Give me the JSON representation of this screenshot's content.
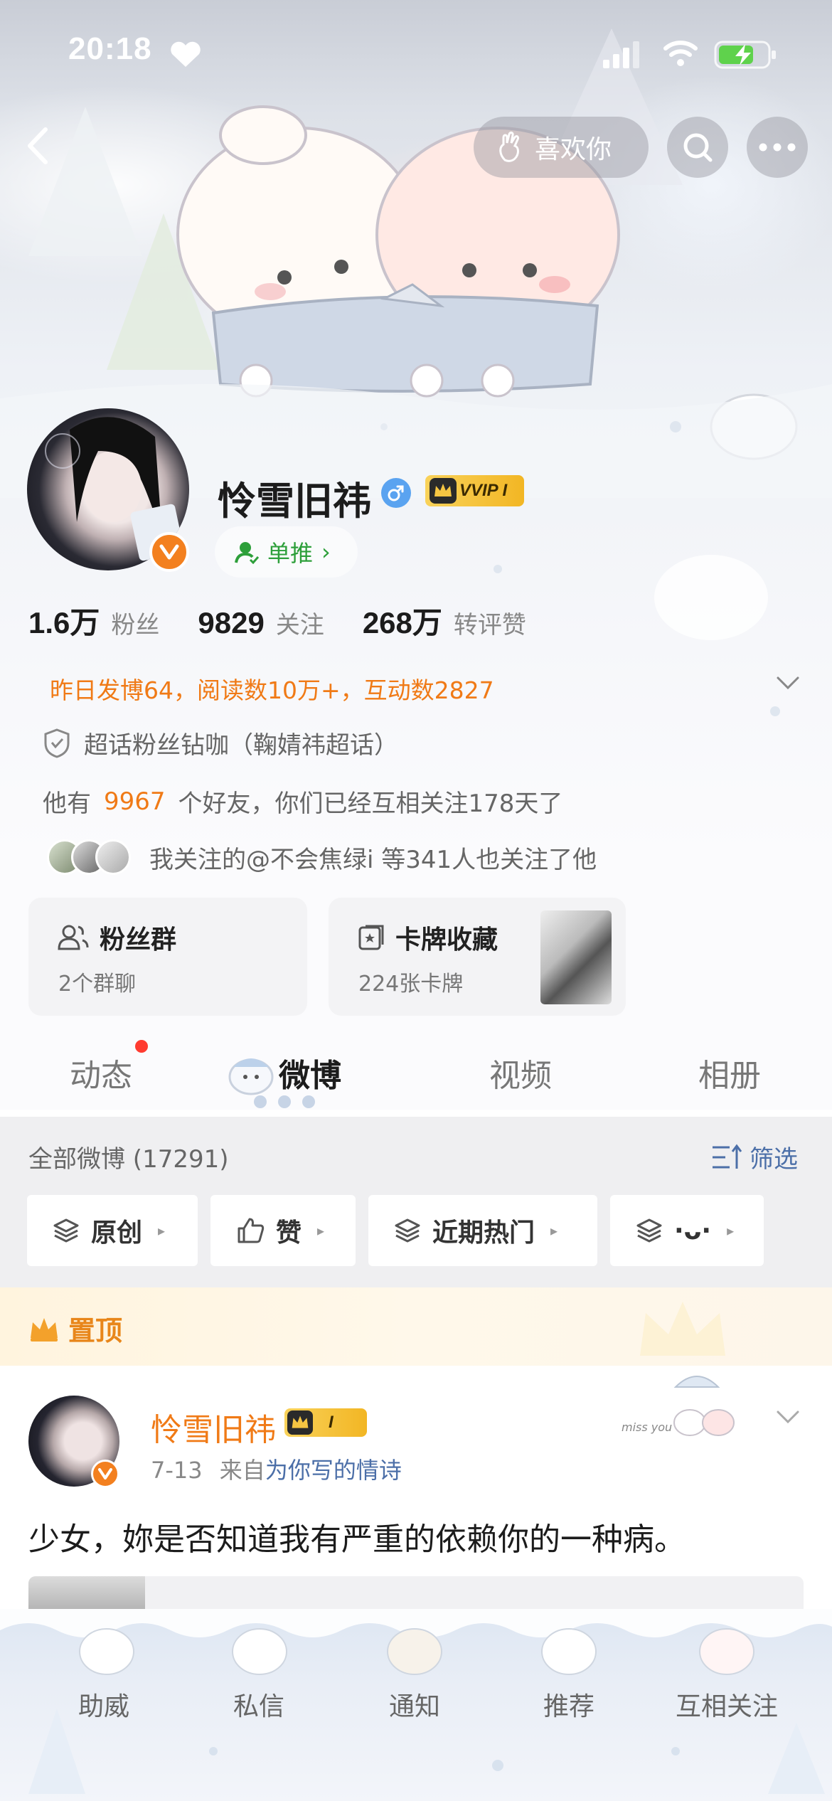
{
  "status_bar": {
    "time": "20:18"
  },
  "nav": {
    "like_label": "喜欢你"
  },
  "profile": {
    "nickname": "怜雪旧祎",
    "vip_label": "VVIP I",
    "dantui_label": "单推",
    "stats": [
      {
        "value": "1.6万",
        "label": "粉丝"
      },
      {
        "value": "9829",
        "label": "关注"
      },
      {
        "value": "268万",
        "label": "转评赞"
      }
    ],
    "yesterday": "昨日发博64，阅读数10万+，互动数2827",
    "supertopic": "超话粉丝钻咖（鞠婧祎超话）",
    "friends_prefix": "他有",
    "friends_count": "9967",
    "friends_suffix": "个好友，你们已经互相关注178天了",
    "mutual": "我关注的@不会焦绿i 等341人也关注了他"
  },
  "cards": [
    {
      "title": "粉丝群",
      "sub": "2个群聊"
    },
    {
      "title": "卡牌收藏",
      "sub": "224张卡牌"
    }
  ],
  "tabs": [
    "动态",
    "微博",
    "视频",
    "相册"
  ],
  "feed": {
    "count_label": "全部微博 (17291)",
    "filter_label": "筛选",
    "chips": [
      "原创",
      "赞",
      "近期热门",
      "·ᴗ·"
    ]
  },
  "pinned": {
    "label": "置顶",
    "author": "怜雪旧祎",
    "badge": "I",
    "date": "7-13",
    "source_prefix": "来自",
    "source": "为你写的情诗",
    "deco_text": "miss you",
    "text": "少女，妳是否知道我有严重的依赖你的一种病。"
  },
  "bottom_bar": [
    "助威",
    "私信",
    "通知",
    "推荐",
    "互相关注"
  ],
  "colors": {
    "accent_orange": "#f07a16",
    "link_blue": "#4c6fa8",
    "verified_orange": "#f3801f",
    "vip_gold": "#f2b624"
  }
}
